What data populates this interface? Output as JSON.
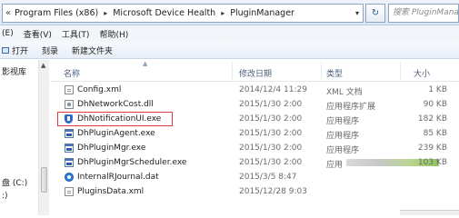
{
  "address_bar": {
    "prefix": "«",
    "crumbs": [
      "Program Files (x86)",
      "Microsoft Device Health",
      "PluginManager"
    ],
    "separator": "▸",
    "dropdown_glyph": "▾",
    "refresh_glyph": "↻",
    "search_placeholder": "搜索 PluginManag"
  },
  "menu": [
    "(E)",
    "查看(V)",
    "工具(T)",
    "帮助(H)"
  ],
  "toolbar": {
    "open_label": "打开",
    "burn_label": "刻录",
    "new_folder_label": "新建文件夹"
  },
  "nav": {
    "items": [
      "影视库",
      "盘 (C:)",
      ":)"
    ],
    "scroll_up_glyph": "▲"
  },
  "columns": {
    "name": "名称",
    "modified": "修改日期",
    "type": "类型",
    "size": "大小",
    "sort_glyph": "▲"
  },
  "files": [
    {
      "name": "Config.xml",
      "modified": "2014/12/4 11:29",
      "type": "XML 文档",
      "size": "1 KB",
      "icon": "xml-doc-icon"
    },
    {
      "name": "DhNetworkCost.dll",
      "modified": "2015/1/30 2:00",
      "type": "应用程序扩展",
      "size": "90 KB",
      "icon": "dll-icon"
    },
    {
      "name": "DhNotificationUI.exe",
      "modified": "2015/1/30 2:00",
      "type": "应用程序",
      "size": "182 KB",
      "icon": "shield-app-icon",
      "highlighted": true
    },
    {
      "name": "DhPluginAgent.exe",
      "modified": "2015/1/30 2:00",
      "type": "应用程序",
      "size": "85 KB",
      "icon": "exe-icon"
    },
    {
      "name": "DhPluginMgr.exe",
      "modified": "2015/1/30 2:00",
      "type": "应用程序",
      "size": "239 KB",
      "icon": "exe-icon"
    },
    {
      "name": "DhPluginMgrScheduler.exe",
      "modified": "2015/1/30 2:00",
      "type": "应用",
      "size": "103 KB",
      "icon": "exe-icon",
      "redacted": true
    },
    {
      "name": "InternalRJournal.dat",
      "modified": "2015/3/5 8:47",
      "type": "",
      "size": "",
      "icon": "dat-icon"
    },
    {
      "name": "PluginsData.xml",
      "modified": "2015/12/28 9:03",
      "type": "",
      "size": "",
      "icon": "xml-doc-icon"
    }
  ],
  "colors": {
    "selection_outline": "#e03a3a",
    "header_text": "#4c607a"
  }
}
